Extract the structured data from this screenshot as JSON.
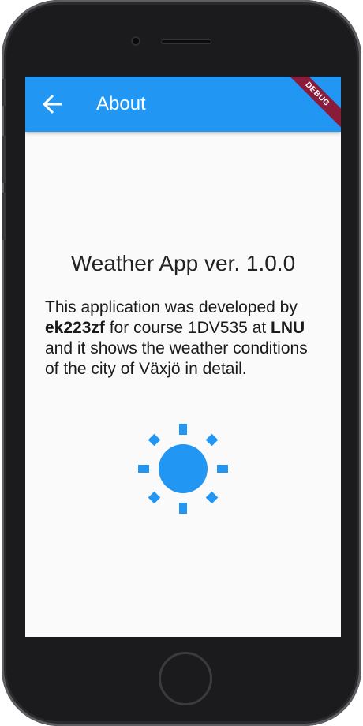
{
  "appbar": {
    "title": "About",
    "back_icon": "arrow-back-icon",
    "color": "#2196f3"
  },
  "debug_banner": "DEBUG",
  "content": {
    "heading": "Weather App ver. 1.0.0",
    "desc_part1": "This application was developed by ",
    "author": "ek223zf",
    "desc_part2": " for course 1DV535 at ",
    "university": "LNU",
    "desc_part3": " and it shows the weather conditions of the city of Växjö in detail.",
    "icon": "sun-icon",
    "icon_color": "#2196f3"
  }
}
